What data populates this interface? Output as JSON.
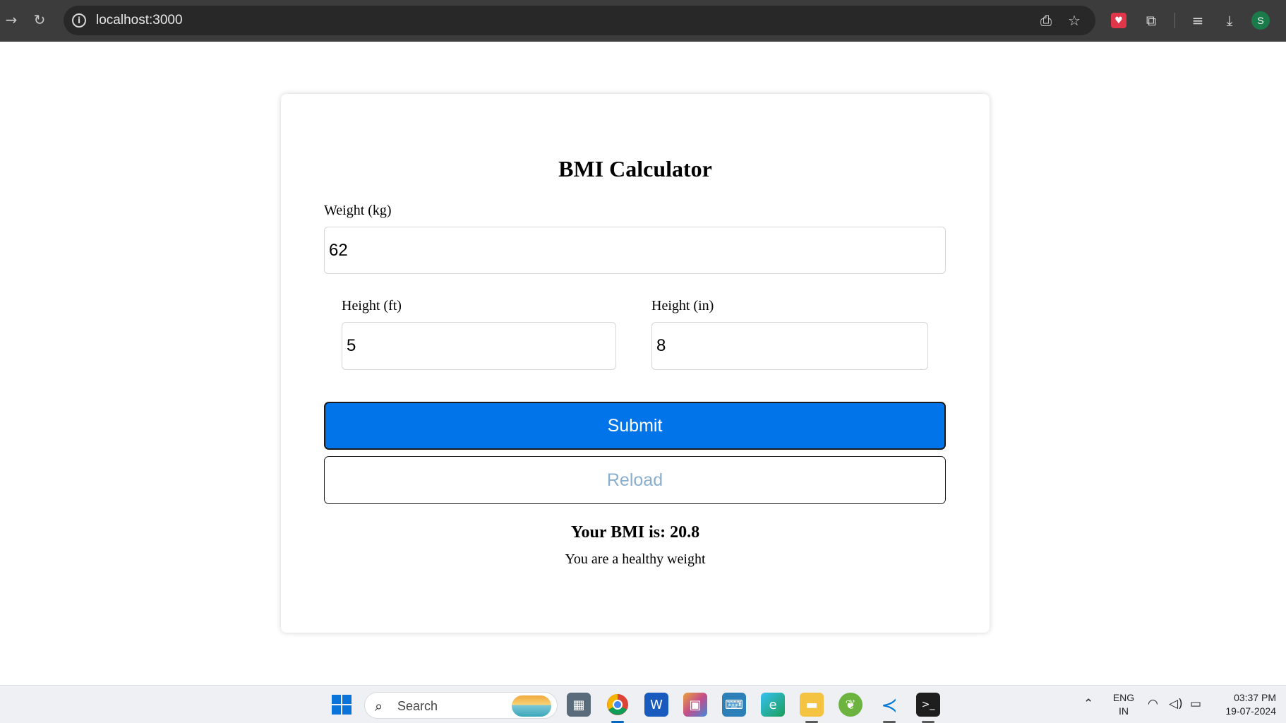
{
  "browser": {
    "url": "localhost:3000",
    "profile_initial": "S",
    "icons": [
      "forward-icon",
      "reload-icon",
      "site-info-icon",
      "install-app-icon",
      "bookmark-star-icon",
      "pocket-icon",
      "extensions-icon",
      "reading-list-icon",
      "downloads-icon"
    ]
  },
  "app": {
    "title": "BMI Calculator",
    "weight": {
      "label": "Weight (kg)",
      "value": "62"
    },
    "height_ft": {
      "label": "Height (ft)",
      "value": "5"
    },
    "height_in": {
      "label": "Height (in)",
      "value": "8"
    },
    "submit_label": "Submit",
    "reload_label": "Reload",
    "result_text": "Your BMI is: 20.8",
    "status_text": "You are a healthy weight",
    "colors": {
      "submit_bg": "#0074e8",
      "reload_text": "#8aaecd"
    }
  },
  "taskbar": {
    "search_placeholder": "Search",
    "apps": [
      "start-icon",
      "search-icon",
      "calculator-icon",
      "chrome-icon",
      "word-icon",
      "photos-icon",
      "keyboard-icon",
      "edge-icon",
      "file-explorer-icon",
      "spring-icon",
      "vscode-icon",
      "terminal-icon"
    ],
    "language_top": "ENG",
    "language_bottom": "IN",
    "time": "03:37 PM",
    "date": "19-07-2024"
  }
}
